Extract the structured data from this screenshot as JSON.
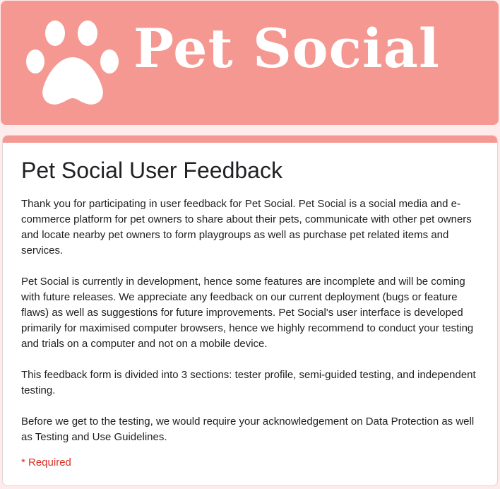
{
  "header": {
    "logo_icon": "paw-icon",
    "brand_text": "Pet Social",
    "brand_color": "#f59892"
  },
  "form": {
    "title": "Pet Social User Feedback",
    "paragraphs": [
      "Thank you for participating in user feedback for Pet Social. Pet Social is a social media and e-commerce platform for pet owners to share about their pets, communicate with other pet owners and locate nearby pet owners to form playgroups as well as purchase pet related items and services.",
      "Pet Social is currently in development, hence some features are incomplete and will be coming with future releases. We appreciate any feedback on our current deployment (bugs or feature flaws) as well as suggestions for future improvements. Pet Social's user interface is developed primarily for maximised computer browsers, hence we highly recommend to conduct your testing and trials on a computer and not on a mobile device.",
      "This feedback form is divided into 3 sections: tester profile, semi-guided testing, and independent testing.",
      "Before we get to the testing, we would require your acknowledgement on Data Protection as well as Testing and Use Guidelines."
    ],
    "required_note": "* Required",
    "required_color": "#d93025"
  }
}
